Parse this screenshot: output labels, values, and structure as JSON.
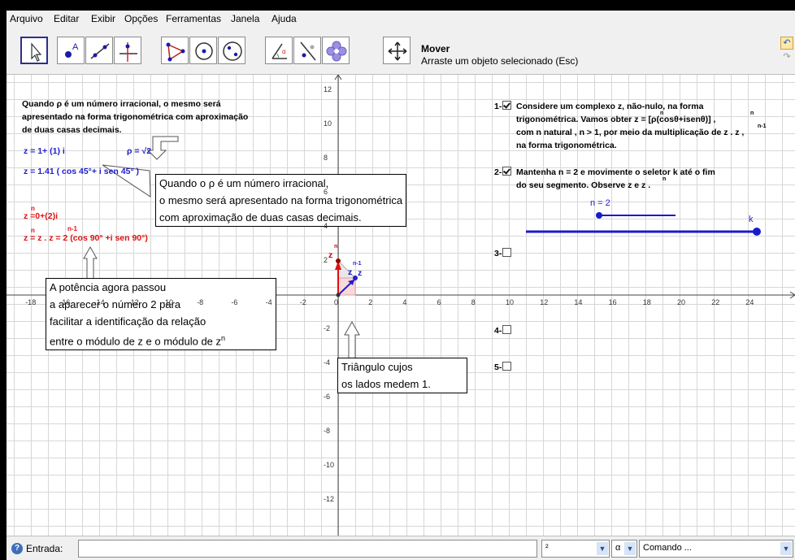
{
  "menu": [
    "Arquivo",
    "Editar",
    "Exibir",
    "Opções",
    "Ferramentas",
    "Janela",
    "Ajuda"
  ],
  "toolbar": {
    "tools": [
      "cursor-tool",
      "point-tool",
      "line-tool",
      "perpendicular-tool",
      "polygon-tool",
      "circle-tool",
      "conic-tool",
      "angle-tool",
      "reflect-tool",
      "slider-tool",
      "move-view-tool"
    ],
    "tool_name": "Mover",
    "tool_help": "Arraste um objeto selecionado (Esc)"
  },
  "graphics": {
    "intro_text": [
      "Quando ρ é um número irracional, o mesmo será",
      "apresentado na forma trigonométrica com aproximação",
      "de duas casas decimais."
    ],
    "z_def": "z = 1+ (1) i",
    "rho": "ρ = √2",
    "z_trig": "z = 1.41 ( cos 45°+ i sen 45° )",
    "zn_alg": "z  =0+(2)i",
    "zn_alg_exp": "n",
    "zn_trig": "z  = z . z     = 2 (cos 90° +i sen 90°)",
    "zn_trig_exp1": "n",
    "zn_trig_exp2": "n-1",
    "box1": [
      "Quando o ρ é um número irracional,",
      "o mesmo será apresentado na forma trigonométrica",
      "com aproximação de duas casas decimais."
    ],
    "box2": [
      "A potência agora passou",
      "a aparecer o número 2 para",
      "facilitar a identificação da relação",
      "entre o módulo de z e o módulo de z"
    ],
    "box2_exp": "n",
    "box3": [
      "Triângulo cujos",
      "os lados medem 1."
    ],
    "point_labels": {
      "zn": "z",
      "zn_exp": "n",
      "z": "z",
      "zn1": "z",
      "zn1_exp": "n-1"
    },
    "steps": {
      "s1_label": "1-",
      "s1_text": [
        "Considere um complexo z, não-nulo, na forma",
        "trigonométrica. Vamos obter  z  = [ρ(cosθ+isenθ)] ,",
        "com n natural , n > 1, por meio da multiplicação de  z . z   ,",
        "na forma trigonométrica."
      ],
      "s1_exps": [
        "n",
        "n",
        "n-1"
      ],
      "s1_checked": true,
      "s2_label": "2-",
      "s2_text": [
        "Mantenha n = 2 e movimente o seletor k até o fim",
        "do seu segmento. Observe z e z ."
      ],
      "s2_exp": "n",
      "s2_checked": true,
      "s3_label": "3-",
      "s4_label": "4-",
      "s5_label": "5-",
      "slider_n_label": "n = 2",
      "slider_k_label": "k",
      "slider_n_value": 2,
      "slider_k_value": 1
    },
    "x_ticks": [
      "-18",
      "-16",
      "-14",
      "-12",
      "-10",
      "-8",
      "-6",
      "-4",
      "-2",
      "0",
      "2",
      "4",
      "6",
      "8",
      "10",
      "12",
      "14",
      "16",
      "18",
      "20",
      "22",
      "24"
    ],
    "y_ticks": [
      "12",
      "10",
      "8",
      "6",
      "4",
      "2",
      "-2",
      "-4",
      "-6",
      "-8",
      "-10",
      "-12"
    ],
    "colors": {
      "blue": "#1f1fcc",
      "red": "#e01010",
      "grid": "#d7d7d7"
    }
  },
  "inputbar": {
    "label": "Entrada:",
    "value": "",
    "sel1": "²",
    "sel2": "α",
    "command_placeholder": "Comando ..."
  }
}
